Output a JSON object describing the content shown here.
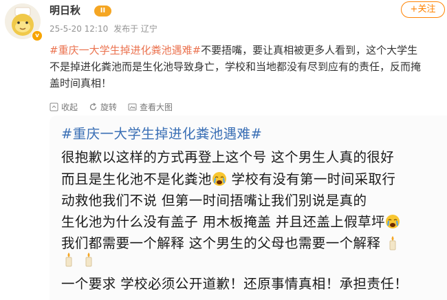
{
  "post": {
    "username": "明日秋",
    "level_badge": "II",
    "verified_badge": "v",
    "time": "25-5-20 12:10",
    "source": "发布于 辽宁",
    "follow_label": "+关注",
    "hashtag": "#重庆一大学生掉进化粪池遇难#",
    "text_line1_rest": "不要捂嘴，要让真相被更多人看到，这个大学生",
    "text_line2": "不是掉进化粪池而是生化池导致身亡，学校和当地都没有尽到应有的责任，反而掩",
    "text_line3": "盖时间真相！"
  },
  "image_toolbar": {
    "collapse_label": "收起",
    "rotate_label": "旋转",
    "view_large_label": "查看大图"
  },
  "image_text": {
    "hashtag": "#重庆一大学生掉进化粪池遇难#",
    "line1": "很抱歉以这样的方式再登上这个号  这个男生人真的很好",
    "line2": "而且是生化池不是化粪池",
    "line2_rest": " 学校有没有第一时间采取行",
    "line3": "动救他我们不说 但第一时间捂嘴让我们别说是真的",
    "line4": "生化池为什么没有盖子 用木板掩盖 并且还盖上假草坪",
    "line5": "我们都需要一个解释 这个男生的父母也需要一个解释",
    "line7": "一个要求 学校必须公开道歉！还原事情真相！承担责任！"
  },
  "icons": [
    "crying-emoji-icon",
    "candle-icon",
    "collapse-icon",
    "rotate-icon",
    "view-large-icon"
  ],
  "colors": {
    "accent": "#ff8200",
    "hashtag": "#eb7350",
    "image_hashtag": "#3a6fb5"
  }
}
